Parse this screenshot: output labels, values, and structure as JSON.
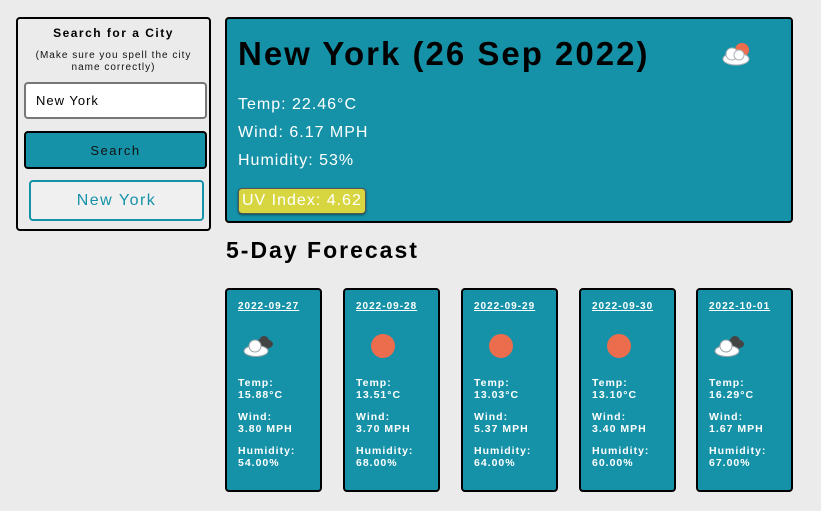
{
  "search": {
    "title": "Search for a City",
    "note": "(Make sure you spell the city name correctly)",
    "input_value": "New York",
    "button_label": "Search",
    "history": [
      "New York"
    ]
  },
  "current": {
    "title": "New York (26 Sep 2022)",
    "icon": "cloud-sun-icon",
    "temp": "Temp: 22.46°C",
    "wind": "Wind: 6.17 MPH",
    "humidity": "Humidity: 53%",
    "uv": "UV Index: 4.62",
    "uv_color": "#d7d640"
  },
  "forecast": {
    "heading": "5-Day Forecast",
    "days": [
      {
        "date": "2022-09-27",
        "icon": "cloud-icon",
        "temp_label": "Temp:",
        "temp": "15.88°C",
        "wind_label": "Wind:",
        "wind": "3.80 MPH",
        "humidity_label": "Humidity:",
        "humidity": "54.00%"
      },
      {
        "date": "2022-09-28",
        "icon": "sun-icon",
        "temp_label": "Temp:",
        "temp": "13.51°C",
        "wind_label": "Wind:",
        "wind": "3.70 MPH",
        "humidity_label": "Humidity:",
        "humidity": "68.00%"
      },
      {
        "date": "2022-09-29",
        "icon": "sun-icon",
        "temp_label": "Temp:",
        "temp": "13.03°C",
        "wind_label": "Wind:",
        "wind": "5.37 MPH",
        "humidity_label": "Humidity:",
        "humidity": "64.00%"
      },
      {
        "date": "2022-09-30",
        "icon": "sun-icon",
        "temp_label": "Temp:",
        "temp": "13.10°C",
        "wind_label": "Wind:",
        "wind": "3.40 MPH",
        "humidity_label": "Humidity:",
        "humidity": "60.00%"
      },
      {
        "date": "2022-10-01",
        "icon": "cloud-icon",
        "temp_label": "Temp:",
        "temp": "16.29°C",
        "wind_label": "Wind:",
        "wind": "1.67 MPH",
        "humidity_label": "Humidity:",
        "humidity": "67.00%"
      }
    ]
  },
  "colors": {
    "accent": "#1592a8",
    "sun": "#ec6c4e",
    "background": "#ebebeb"
  }
}
